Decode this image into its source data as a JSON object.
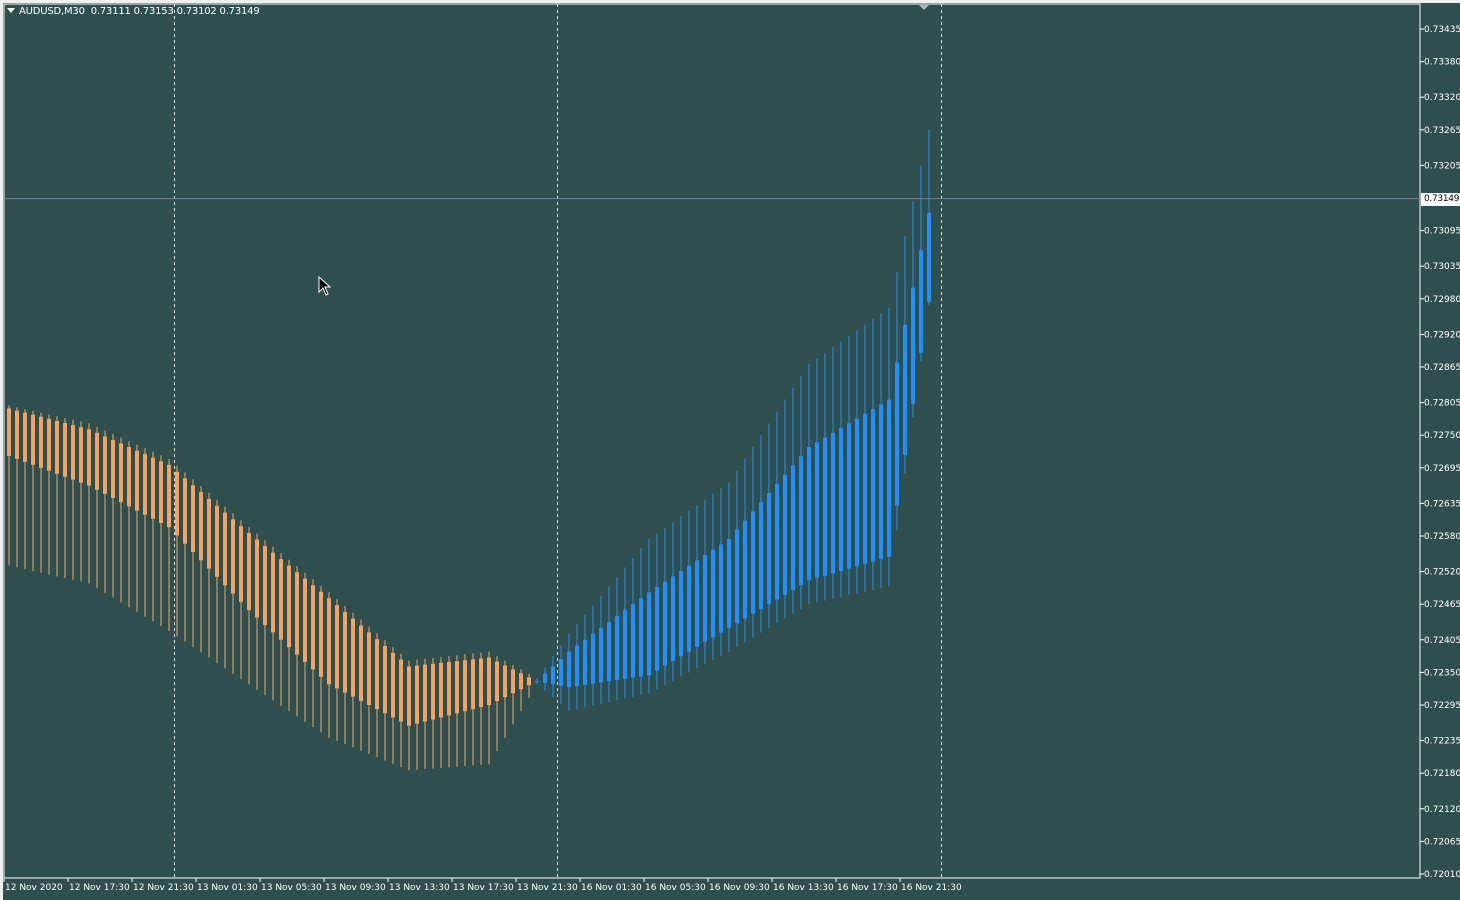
{
  "window": {
    "symbol": "AUDUSD,M30",
    "ohlc": "0.73111 0.73153 0.73102 0.73149"
  },
  "colors": {
    "background": "#2f4f4f",
    "bearish": "#f4a460",
    "bullish": "#1e90ff",
    "axis_text": "#ffffff",
    "grid_lines": "#ffffff",
    "bid_line": "#708090"
  },
  "current_price": "0.73149",
  "price_axis": {
    "labels": [
      "0.73435",
      "0.73380",
      "0.73320",
      "0.73265",
      "0.73205",
      "0.73095",
      "0.73035",
      "0.72980",
      "0.72920",
      "0.72865",
      "0.72805",
      "0.72750",
      "0.72695",
      "0.72635",
      "0.72580",
      "0.72520",
      "0.72465",
      "0.72405",
      "0.72350",
      "0.72295",
      "0.72235",
      "0.72180",
      "0.72120",
      "0.72065",
      "0.72010"
    ]
  },
  "time_axis": {
    "labels": [
      "12 Nov 2020",
      "12 Nov 17:30",
      "12 Nov 21:30",
      "13 Nov 01:30",
      "13 Nov 05:30",
      "13 Nov 09:30",
      "13 Nov 13:30",
      "13 Nov 17:30",
      "13 Nov 21:30",
      "16 Nov 01:30",
      "16 Nov 05:30",
      "16 Nov 09:30",
      "16 Nov 13:30",
      "16 Nov 17:30",
      "16 Nov 21:30"
    ]
  },
  "chart_data": {
    "type": "candlestick",
    "timeframe": "M30",
    "symbol": "AUDUSD",
    "ylim": [
      0.72,
      0.7345
    ],
    "bar_count": 115,
    "candles": [
      {
        "i": 0,
        "o": 0.72795,
        "c": 0.72715,
        "h": 0.728,
        "l": 0.7253
      },
      {
        "i": 10,
        "o": 0.7276,
        "c": 0.72665,
        "h": 0.7277,
        "l": 0.725
      },
      {
        "i": 20,
        "o": 0.727,
        "c": 0.72595,
        "h": 0.7271,
        "l": 0.7242
      },
      {
        "i": 30,
        "o": 0.72585,
        "c": 0.72455,
        "h": 0.72595,
        "l": 0.7233
      },
      {
        "i": 40,
        "o": 0.72475,
        "c": 0.7233,
        "h": 0.72485,
        "l": 0.7224
      },
      {
        "i": 50,
        "o": 0.7236,
        "c": 0.7226,
        "h": 0.7237,
        "l": 0.72185
      },
      {
        "i": 60,
        "o": 0.72375,
        "c": 0.72295,
        "h": 0.72385,
        "l": 0.72195
      },
      {
        "i": 66,
        "o": 0.72335,
        "c": 0.72335,
        "h": 0.7234,
        "l": 0.7233
      },
      {
        "i": 70,
        "o": 0.72325,
        "c": 0.72385,
        "h": 0.72415,
        "l": 0.72285
      },
      {
        "i": 80,
        "o": 0.72345,
        "c": 0.72485,
        "h": 0.72575,
        "l": 0.72315
      },
      {
        "i": 90,
        "o": 0.72425,
        "c": 0.72575,
        "h": 0.7267,
        "l": 0.72385
      },
      {
        "i": 100,
        "o": 0.72505,
        "c": 0.7273,
        "h": 0.7287,
        "l": 0.72465
      },
      {
        "i": 110,
        "o": 0.72545,
        "c": 0.7281,
        "h": 0.72965,
        "l": 0.72495
      },
      {
        "i": 115,
        "o": 0.72975,
        "c": 0.73125,
        "h": 0.73265,
        "l": 0.7297
      }
    ]
  }
}
